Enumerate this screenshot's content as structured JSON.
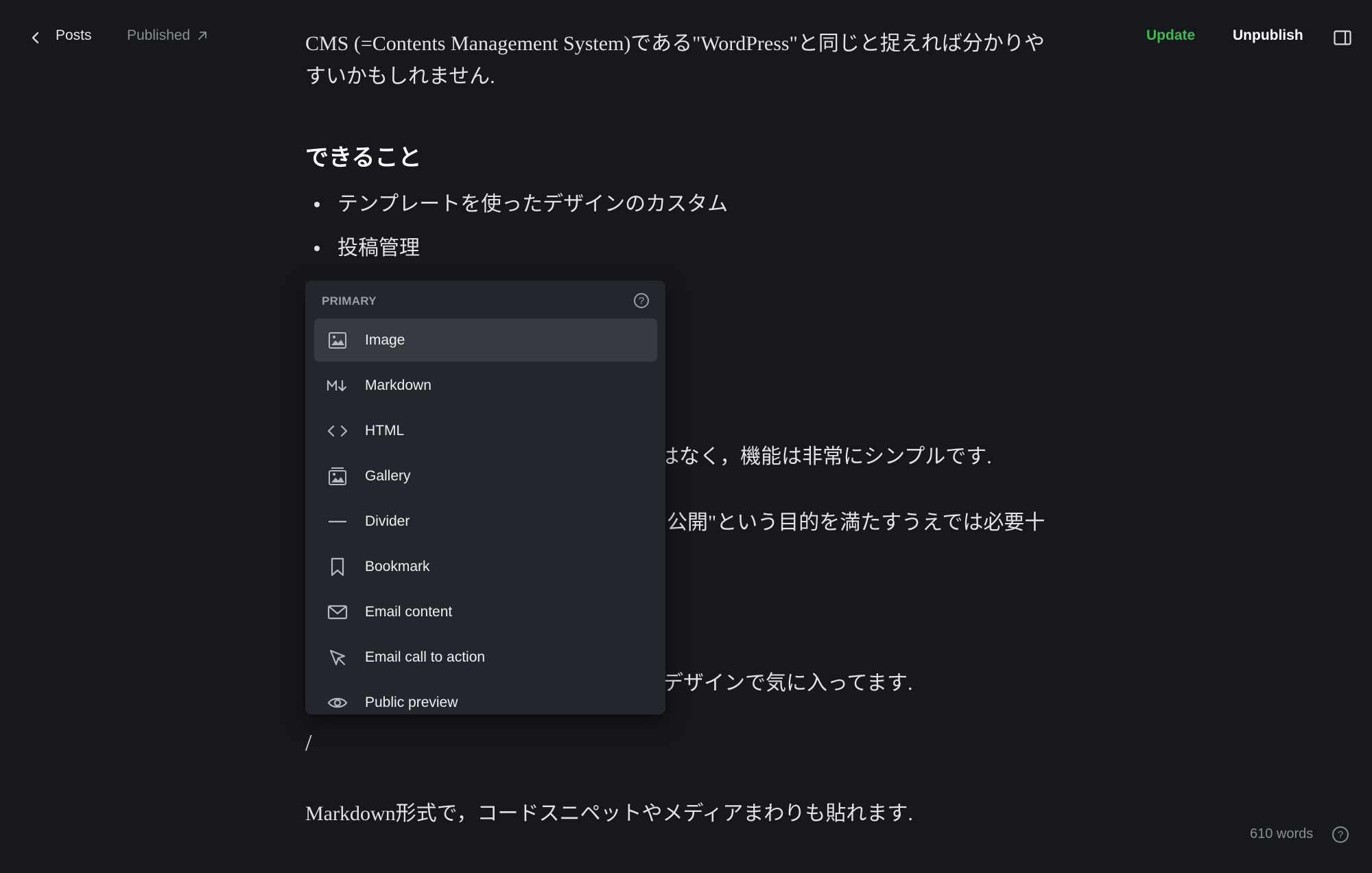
{
  "topbar": {
    "back_label": "Posts",
    "status_label": "Published",
    "update_label": "Update",
    "unpublish_label": "Unpublish"
  },
  "content": {
    "intro": "CMS (=Contents Management System)である\"WordPress\"と同じと捉えれば分かりやすいかもしれません.",
    "heading": "できること",
    "list": [
      "テンプレートを使ったデザインのカスタム",
      "投稿管理"
    ],
    "fragment_1": "はなく，機能は非常にシンプルです.",
    "fragment_2": "公開\"という目的を満たすうえでは必要十",
    "fragment_3": "デザインで気に入ってます.",
    "slash": "/",
    "markdown_line": "Markdown形式で，コードスニペットやメディアまわりも貼れます."
  },
  "menu": {
    "header": "PRIMARY",
    "items": [
      {
        "label": "Image",
        "icon": "image-icon"
      },
      {
        "label": "Markdown",
        "icon": "markdown-icon"
      },
      {
        "label": "HTML",
        "icon": "code-icon"
      },
      {
        "label": "Gallery",
        "icon": "gallery-icon"
      },
      {
        "label": "Divider",
        "icon": "divider-icon"
      },
      {
        "label": "Bookmark",
        "icon": "bookmark-icon"
      },
      {
        "label": "Email content",
        "icon": "mail-icon"
      },
      {
        "label": "Email call to action",
        "icon": "cursor-icon"
      },
      {
        "label": "Public preview",
        "icon": "eye-icon"
      }
    ],
    "active_index": 0
  },
  "footer": {
    "word_count": "610 words"
  },
  "colors": {
    "background": "#17181c",
    "accent_green": "#3fb950",
    "menu_bg": "#23262c"
  }
}
